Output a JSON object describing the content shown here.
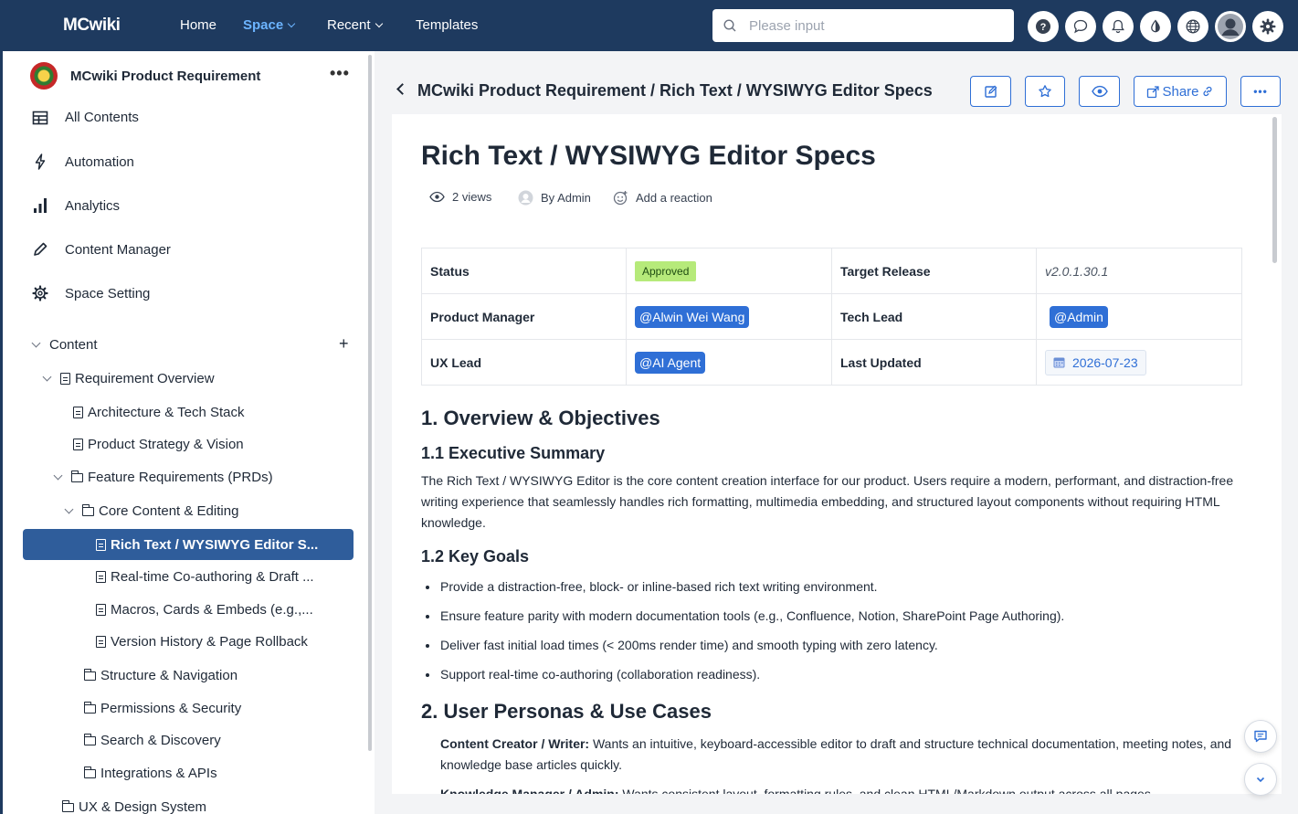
{
  "topbar": {
    "logo": "MCwiki",
    "nav": [
      {
        "label": "Home"
      },
      {
        "label": "Space"
      },
      {
        "label": "Recent"
      },
      {
        "label": "Templates"
      }
    ],
    "search_placeholder": "Please input"
  },
  "sidebar": {
    "space_title": "MCwiki Product Requirement",
    "more": "•••",
    "menu": [
      {
        "label": "All Contents"
      },
      {
        "label": "Automation"
      },
      {
        "label": "Analytics"
      },
      {
        "label": "Content Manager"
      },
      {
        "label": "Space Setting"
      }
    ],
    "content_label": "Content",
    "add": "+",
    "tree": [
      {
        "label": "Requirement Overview"
      },
      {
        "label": "Architecture & Tech Stack"
      },
      {
        "label": "Product Strategy & Vision"
      },
      {
        "label": "Feature Requirements (PRDs)"
      },
      {
        "label": "Core Content & Editing"
      },
      {
        "label": "Rich Text / WYSIWYG Editor S..."
      },
      {
        "label": "Real-time Co-authoring & Draft ..."
      },
      {
        "label": "Macros, Cards & Embeds (e.g.,..."
      },
      {
        "label": "Version History & Page Rollback"
      },
      {
        "label": "Structure & Navigation"
      },
      {
        "label": "Permissions & Security"
      },
      {
        "label": "Search & Discovery"
      },
      {
        "label": "Integrations & APIs"
      },
      {
        "label": "UX & Design System"
      }
    ]
  },
  "main": {
    "breadcrumb": "MCwiki Product Requirement / Rich Text / WYSIWYG Editor Specs",
    "share_label": "Share",
    "more": "•••",
    "title": "Rich Text / WYSIWYG Editor Specs",
    "views": "2 views",
    "author": "By Admin",
    "reaction": "Add a reaction",
    "props": {
      "status_key": "Status",
      "status_val": "Approved",
      "release_key": "Target Release",
      "release_val": "v2.0.1.30.1",
      "pm_key": "Product Manager",
      "pm_val": "@Alwin Wei Wang",
      "tl_key": "Tech Lead",
      "tl_val": "@Admin",
      "ux_key": "UX Lead",
      "ux_val": "@AI Agent",
      "updated_key": "Last Updated",
      "updated_val": "2026-07-23"
    },
    "s1_title": "1. Overview & Objectives",
    "s11_title": "1.1 Executive Summary",
    "s11_body": "The Rich Text / WYSIWYG Editor is the core content creation interface for our product. Users require a modern, performant, and distraction-free writing experience that seamlessly handles rich formatting, multimedia embedding, and structured layout components without requiring HTML knowledge.",
    "s12_title": "1.2 Key Goals",
    "goals": [
      "Provide a distraction-free, block- or inline-based rich text writing environment.",
      "Ensure feature parity with modern documentation tools (e.g., Confluence, Notion, SharePoint Page Authoring).",
      "Deliver fast initial load times (< 200ms render time) and smooth typing with zero latency.",
      "Support real-time co-authoring (collaboration readiness)."
    ],
    "s2_title": "2. User Personas & Use Cases",
    "persona1_name": "Content Creator / Writer:",
    "persona1_desc": " Wants an intuitive, keyboard-accessible editor to draft and structure technical documentation, meeting notes, and knowledge base articles quickly.",
    "persona2_name": "Knowledge Manager / Admin:",
    "persona2_desc": " Wants consistent layout, formatting rules, and clean HTML/Markdown output across all pages."
  },
  "colors": {
    "topbar": "#1e3a5f",
    "accent": "#2f6fd6",
    "selected": "#2f5d9b",
    "approved": "#b6ea7a"
  }
}
